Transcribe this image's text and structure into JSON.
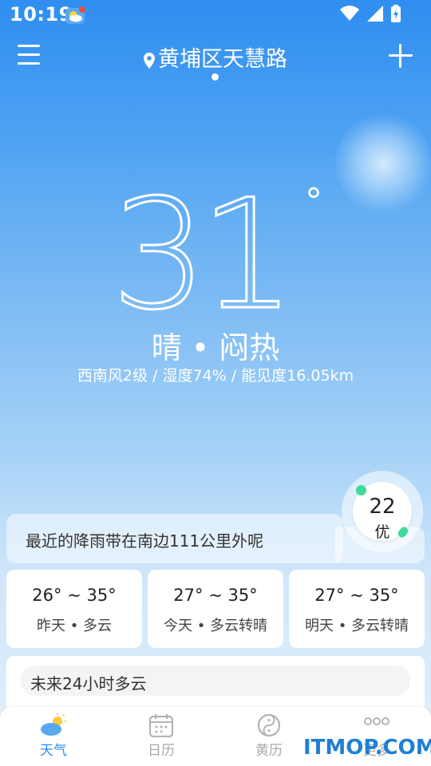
{
  "status_bar": {
    "time": "10:19"
  },
  "header": {
    "location": "黄埔区天慧路"
  },
  "current": {
    "temperature": "31",
    "degree_symbol": "°",
    "condition": "晴 • 闷热",
    "details": "西南风2级 / 湿度74% / 能见度16.05km"
  },
  "aqi": {
    "value": "22",
    "label": "优"
  },
  "rain_banner": {
    "text": "最近的降雨带在南边111公里外呢"
  },
  "days": [
    {
      "temp": "26° ~ 35°",
      "desc": "昨天 • 多云"
    },
    {
      "temp": "27° ~ 35°",
      "desc": "今天 • 多云转晴"
    },
    {
      "temp": "27° ~ 35°",
      "desc": "明天 • 多云转晴"
    }
  ],
  "hourly": {
    "summary": "未来24小时多云"
  },
  "nav": [
    {
      "label": "天气",
      "icon": "weather-icon"
    },
    {
      "label": "日历",
      "icon": "calendar-icon"
    },
    {
      "label": "黄历",
      "icon": "yin-yang-icon"
    },
    {
      "label": "更多",
      "icon": "more-icon"
    }
  ],
  "watermark": "ITMOP.COM",
  "colors": {
    "accent": "#2f8ef0",
    "aqi_good": "#3fd99b"
  }
}
